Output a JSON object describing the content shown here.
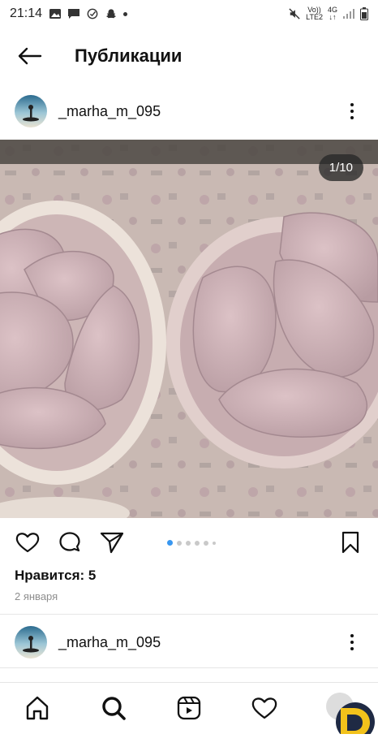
{
  "status_bar": {
    "time": "21:14",
    "net_top": "Vo))",
    "net_bottom": "LTE2",
    "gen": "4G",
    "gen_arrows": "↓↑"
  },
  "header": {
    "title": "Публикации"
  },
  "post": {
    "username": "_marha_m_095",
    "counter": "1/10",
    "likes": "Нравится: 5",
    "date": "2 января"
  },
  "next_post": {
    "username": "_marha_m_095"
  },
  "colors": {
    "accent": "#3897f0",
    "text": "#111111",
    "muted": "#8e8e8e",
    "logo_yellow": "#f2c21b",
    "logo_dark": "#1f2a44"
  },
  "icons": {
    "back": "arrow-left-icon",
    "more": "more-vertical-icon",
    "like": "heart-icon",
    "comment": "comment-icon",
    "share": "send-icon",
    "save": "bookmark-icon",
    "home": "home-icon",
    "search": "search-icon",
    "reels": "reels-icon",
    "activity": "heart-icon",
    "profile": "profile-avatar-icon"
  }
}
